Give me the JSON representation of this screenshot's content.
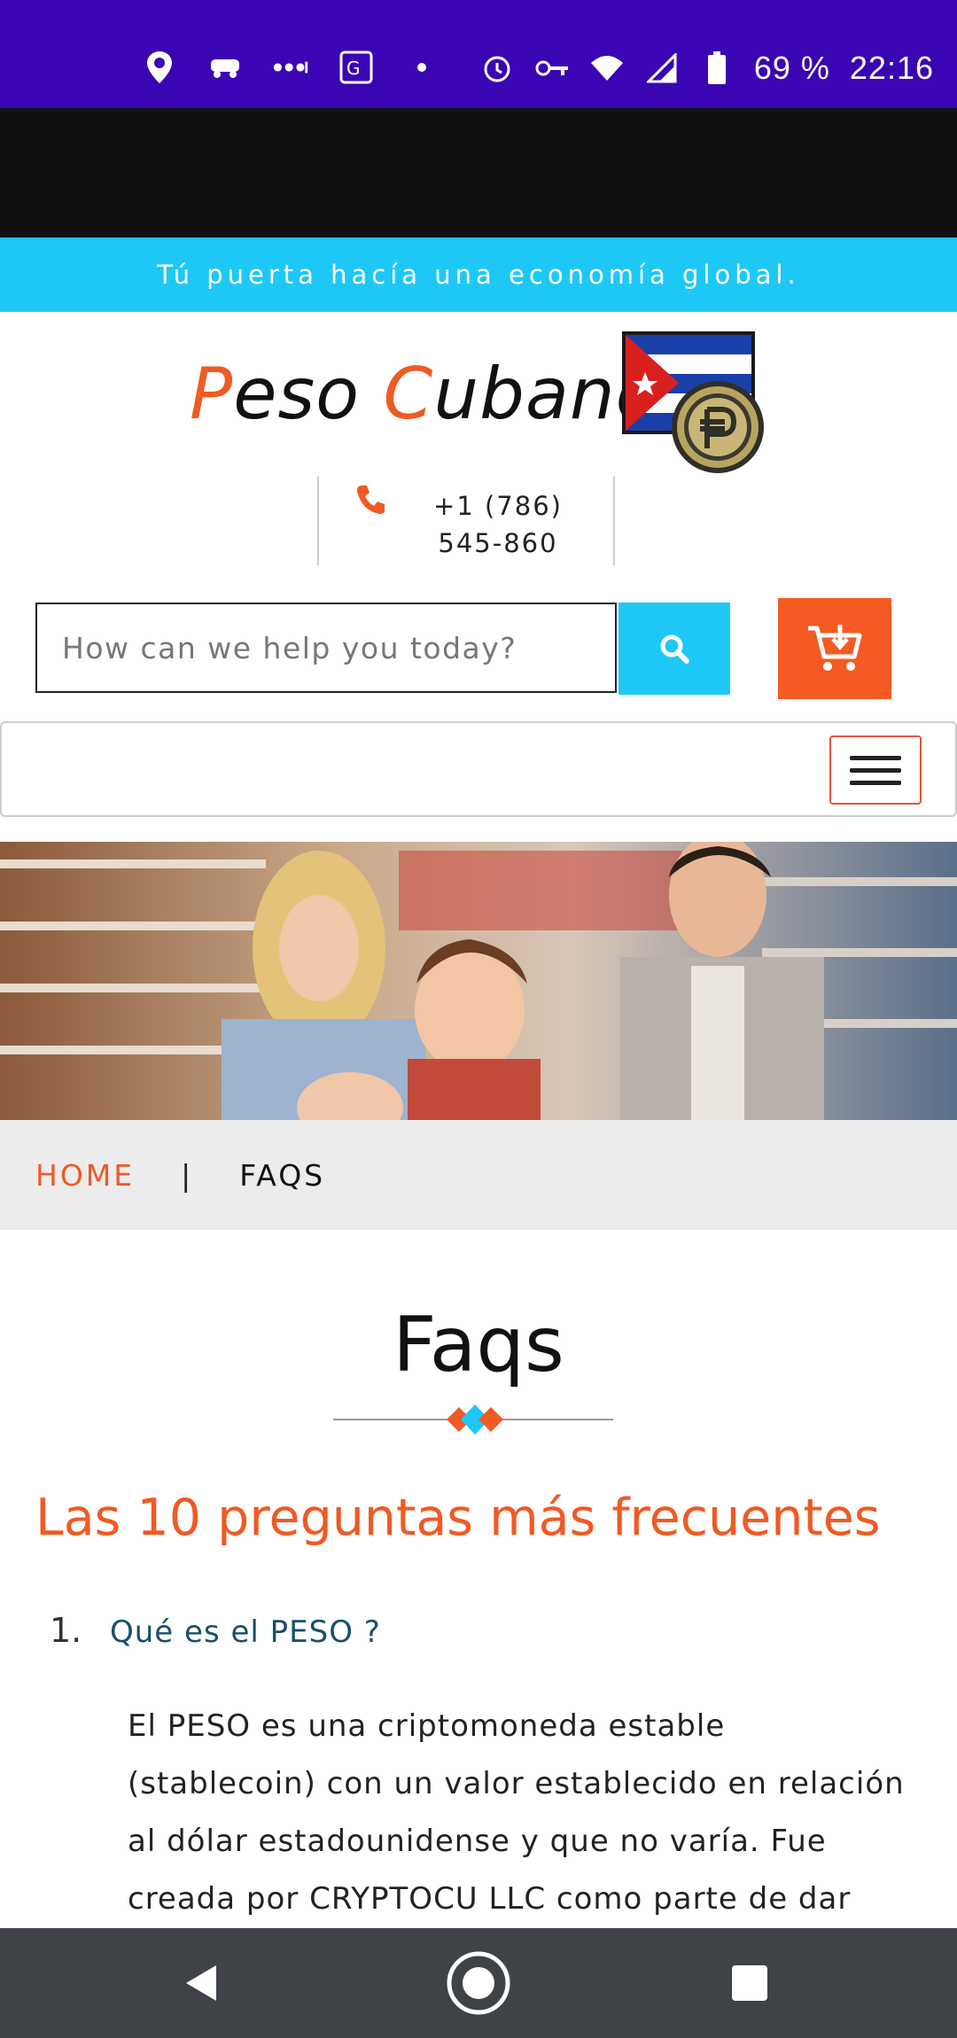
{
  "status_bar": {
    "battery": "69 %",
    "time": "22:16",
    "left_icons": [
      "location-icon",
      "car-icon",
      "more-dots-icon",
      "translate-icon",
      "dot-icon"
    ],
    "right_icons": [
      "alarm-icon",
      "key-icon",
      "wifi-icon",
      "signal-icon",
      "battery-icon"
    ]
  },
  "header": {
    "tagline": "Tú puerta hacía una economía global.",
    "logo": {
      "p1": "P",
      "p2": "eso ",
      "c1": "C",
      "c2": "ubano"
    },
    "phone": "+1 (786) 545-860"
  },
  "search": {
    "placeholder": "How can we help you today?"
  },
  "breadcrumb": {
    "home": "HOME",
    "separator": "|",
    "current": "FAQS"
  },
  "content": {
    "title": "Faqs",
    "section_heading": "Las 10 preguntas más frecuentes",
    "questions": [
      {
        "number": "1.",
        "question": "Qué es el PESO ?",
        "answer": "El PESO es una criptomoneda estable (stablecoin) con un valor establecido en relación al dólar estadounidense y que no varía. Fue creada por CRYPTOCU LLC como parte de dar valor real a una"
      }
    ]
  },
  "colors": {
    "status_bar": "#3a06b3",
    "accent_orange": "#f05a23",
    "accent_cyan": "#1ec8f6",
    "nav_bar": "#3f4347"
  }
}
